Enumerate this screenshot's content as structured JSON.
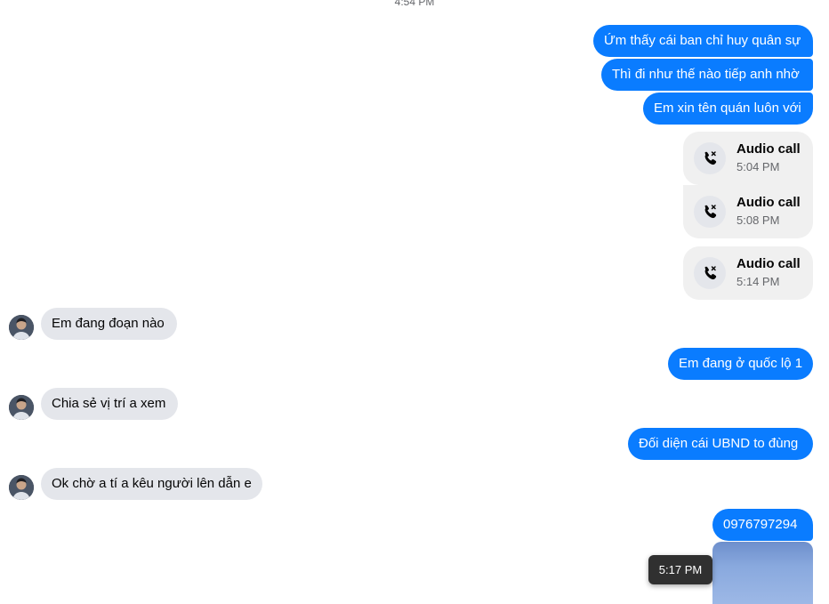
{
  "top_timestamp": "4:54 PM",
  "colors": {
    "outgoing": "#0a7cff",
    "incoming": "#e4e6eb",
    "call_card": "#f0f0f0"
  },
  "outgoing_top": [
    "Ứm thấy cái ban chỉ huy quân sự",
    "Thì đi như thế nào tiếp anh nhờ",
    "Em xin tên quán luôn với"
  ],
  "calls": [
    {
      "title": "Audio call",
      "time": "5:04 PM",
      "icon": "missed-call-icon"
    },
    {
      "title": "Audio call",
      "time": "5:08 PM",
      "icon": "missed-call-icon"
    },
    {
      "title": "Audio call",
      "time": "5:14 PM",
      "icon": "missed-call-icon"
    }
  ],
  "incoming": [
    "Em đang đoạn nào",
    "Chia sẻ vị trí a xem",
    "Ok chờ a tí a kêu người lên dẫn e"
  ],
  "outgoing_bottom": [
    "Em đang ở quốc lộ 1",
    "Đối diện cái UBND to đùng",
    "0976797294"
  ],
  "tooltip_time": "5:17 PM"
}
